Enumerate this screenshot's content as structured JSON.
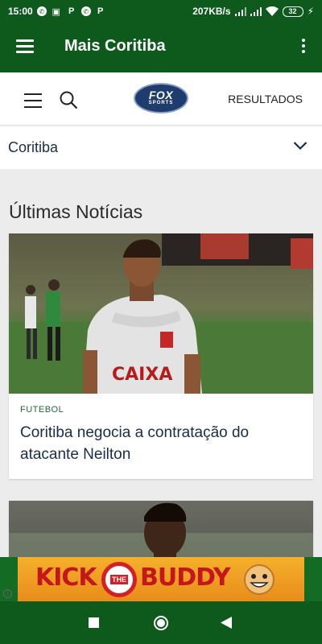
{
  "status_bar": {
    "time": "15:00",
    "network_speed": "207KB/s",
    "battery": "32"
  },
  "app_bar": {
    "title": "Mais Coritiba"
  },
  "nav": {
    "results_label": "RESULTADOS",
    "logo_main": "FOX",
    "logo_sub": "SPORTS"
  },
  "team_selector": {
    "selected": "Coritiba"
  },
  "section": {
    "title": "Últimas Notícias"
  },
  "articles": [
    {
      "category": "FUTEBOL",
      "headline": "Coritiba negocia a contratação do atacante Neilton",
      "jersey_text": "CAIXA"
    }
  ],
  "ad": {
    "text_left": "KICK",
    "text_middle": "THE",
    "text_right": "BUDDY",
    "info": "i"
  },
  "colors": {
    "brand_green": "#0e5a1c",
    "headline_navy": "#1a2c4a",
    "category_green": "#1d6b3a"
  }
}
